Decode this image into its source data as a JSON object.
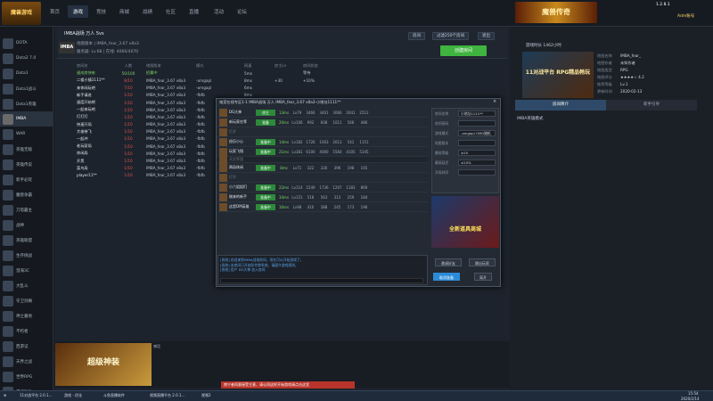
{
  "app": {
    "logo_text": "魔兽游戏",
    "version": "1.2.8.1"
  },
  "topnav": [
    "首页",
    "游戏",
    "竞技",
    "商城",
    "战绩",
    "社区",
    "直播",
    "活动",
    "论坛"
  ],
  "banner_text": "魔兽传奇",
  "right_top": {
    "user": "Adm账号",
    "btn1": "游戏1账号",
    "btn2": "游戏2账号",
    "notice": "大厅公告"
  },
  "left_games": [
    "DOTA",
    "Dota2 7.0",
    "Dota1",
    "Dota1战斗",
    "Dota1英雄",
    "IMBA",
    "WAR",
    "英雄无敌",
    "英雄传说",
    "新手必玩",
    "魔兽争霸",
    "刀塔霸主",
    "战神",
    "英雄联盟",
    "生存挑战",
    "澄海3C",
    "大乱斗",
    "守卫剑阁",
    "神之墓地",
    "不朽者",
    "西游记",
    "天界之战",
    "世界RPG",
    "遗迹攻防"
  ],
  "room": {
    "name": "IMBA战场 万人 5vs",
    "subtitle": "地图版本 | IMBA_fear_3.67 v8a3",
    "server": "服务器: Lv.68 | 在线: 4066/4070",
    "logo": "IMBA",
    "btn_browse": "房间",
    "btn_refresh": "刷新",
    "btn_filter": "过滤250个房间",
    "btn_exit": "退出",
    "btn_create": "创建房间"
  },
  "table": {
    "headers": [
      "房间名",
      "人数",
      "地图版本",
      "模式",
      "网速",
      "房主Lv",
      "房间状态"
    ],
    "rows": [
      [
        "速成房快来",
        "50/100",
        "招募中",
        "",
        "5ms",
        "",
        "等待"
      ],
      [
        "二楼小镇1111**",
        "8/10",
        "IMBA_fear_3.67 v8a3",
        "-omgapl",
        "8ms",
        "+30",
        "+10%"
      ],
      [
        "来休闲玩吧",
        "7/10",
        "IMBA_fear_3.67 v8a3",
        "-omgapl",
        "6ms",
        "",
        ""
      ],
      [
        "新手请进",
        "1/10",
        "IMBA_fear_3.67 v8a3",
        "-fbfb",
        "8ms",
        "",
        ""
      ],
      [
        "速度开始吧",
        "1/10",
        "IMBA_fear_3.67 v8a3",
        "-fbfb",
        "9ms",
        "",
        ""
      ],
      [
        "一起来玩吧",
        "1/10",
        "IMBA_fear_3.67 v8a3",
        "-fbfb",
        "9ms",
        "",
        ""
      ],
      [
        "打打打",
        "1/10",
        "IMBA_fear_3.67 v8a3",
        "-fbfb",
        "9ms",
        "",
        ""
      ],
      [
        "快速开局",
        "1/10",
        "IMBA_fear_3.67 v8a3",
        "-fbfb",
        "9ms",
        "",
        ""
      ],
      [
        "大佬带飞",
        "1/10",
        "IMBA_fear_3.67 v8a3",
        "-fbfb",
        "9ms",
        "",
        ""
      ],
      [
        "一起冲",
        "1/10",
        "IMBA_fear_3.67 v8a3",
        "-fbfb",
        "9ms",
        "",
        ""
      ],
      [
        "老玩家局",
        "1/10",
        "IMBA_fear_3.67 v8a3",
        "-fbfb",
        "9ms",
        "",
        ""
      ],
      [
        "休闲局",
        "1/10",
        "IMBA_fear_3.67 v8a3",
        "-fbfb",
        "9ms",
        "",
        ""
      ],
      [
        "开黑",
        "1/10",
        "IMBA_fear_3.67 v8a3",
        "-fbfb",
        "9ms",
        "",
        ""
      ],
      [
        "菜鸟局",
        "1/10",
        "IMBA_fear_3.67 v8a3",
        "-fbfb",
        "9ms",
        "",
        ""
      ],
      [
        "player11**",
        "1/10",
        "IMBA_fear_3.67 v8a3",
        "-fbfb",
        "9ms",
        "",
        ""
      ]
    ]
  },
  "dialog": {
    "title": "电竞在线专区1-1 IMBA战场 万人 IMBA_fear_3.67 v8a3-小地址1111**",
    "close": "×",
    "slot_headers": [
      "近卫军团",
      "",
      "",
      "",
      "",
      "",
      ""
    ],
    "slots": [
      {
        "name": "DG大神",
        "tag": "房主",
        "v": [
          "13ms",
          "Lv79",
          "3466",
          "3401",
          "3066",
          "2641",
          "2512"
        ]
      },
      {
        "name": "新玩家在等",
        "tag": "准备",
        "v": [
          "20ms",
          "Lv106",
          "992",
          "608",
          "1011",
          "566",
          "486"
        ]
      },
      {
        "name": "打开",
        "tag": "",
        "v": [
          "",
          "",
          "",
          "",
          "",
          "",
          ""
        ]
      },
      {
        "name": "经历小心",
        "tag": "准备中",
        "v": [
          "14ms",
          "Lv182",
          "1726",
          "1003",
          "2613",
          "541",
          "1151"
        ]
      },
      {
        "name": "玩家飞翔",
        "tag": "准备中",
        "v": [
          "21ms",
          "Lv381",
          "6100",
          "4000",
          "5564",
          "4105",
          "5345"
        ]
      },
      {
        "name": "天灾军团",
        "tag": "",
        "v": [
          "",
          "",
          "",
          "",
          "",
          "",
          ""
        ]
      },
      {
        "name": "两局休闲",
        "tag": "准备中",
        "v": [
          "8ms",
          "Lv71",
          "322",
          "330",
          "396",
          "198",
          "165"
        ]
      },
      {
        "name": "打开",
        "tag": "",
        "v": [
          "",
          "",
          "",
          "",
          "",
          "",
          ""
        ]
      },
      {
        "name": "小六姐姐们",
        "tag": "准备中",
        "v": [
          "22ms",
          "Lv114",
          "1549",
          "1736",
          "1207",
          "1183",
          "869"
        ]
      },
      {
        "name": "刚来的新手",
        "tag": "准备中",
        "v": [
          "34ms",
          "Lv151",
          "518",
          "563",
          "313",
          "259",
          "184"
        ]
      },
      {
        "name": "这是DM英雄",
        "tag": "准备中",
        "v": [
          "16ms",
          "Lv98",
          "410",
          "388",
          "245",
          "173",
          "196"
        ]
      }
    ],
    "settings": [
      {
        "label": "房间名称",
        "value": "小地址1111**"
      },
      {
        "label": "房间密码",
        "value": ""
      },
      {
        "label": "游戏模式",
        "value": "-omgapl  OMG随机"
      },
      {
        "label": "地图版本",
        "value": ""
      },
      {
        "label": "最低等级",
        "value": "≥20"
      },
      {
        "label": "最高延迟",
        "value": "≤10%"
      },
      {
        "label": "开局时间",
        "value": ""
      }
    ],
    "ad_text": "全新道具商城",
    "chat": [
      "[系统] 欢迎来到IMBA战场房间，现在可以开始游戏了。",
      "[系统] 本房间已开启防作弊系统，请遵守游戏规则。",
      "[系统] 用户 DG大神 加入房间"
    ],
    "chat_input_placeholder": "",
    "btn_invite": "邀请好友",
    "btn_kick": "踢出玩家",
    "btn_start": "取消准备",
    "btn_leave": "离开"
  },
  "rightpanel": {
    "title": "游戏时长 1462小时",
    "img_text": "11对战平台 RPG精品畅玩",
    "info": [
      {
        "k": "地图名称",
        "v": "IMBA_fear_"
      },
      {
        "k": "地图作者",
        "v": "未知作者"
      },
      {
        "k": "地图类型",
        "v": "RPG"
      },
      {
        "k": "地图评分",
        "v": "★★★★☆ 4.2"
      },
      {
        "k": "推荐等级",
        "v": "Lv.1"
      },
      {
        "k": "更新时间",
        "v": "2020-02-13"
      }
    ],
    "tab_active": "房间简介",
    "tab_inactive": "新手引导",
    "desc": "IMBA英雄模式"
  },
  "bottom": {
    "pic_text": "超级神装",
    "input_label": "喊话"
  },
  "taskbar": {
    "alert": "南宁者同意接受主意，请认同这样开始游戏请点击这里",
    "items": [
      "11对战平台 2.0.1...",
      "游戏 - 优化",
      "斗鱼直播软件",
      "视频直播平台 2.0.1...",
      "视频2"
    ],
    "time": "15:54",
    "date": "2020/2/14"
  }
}
